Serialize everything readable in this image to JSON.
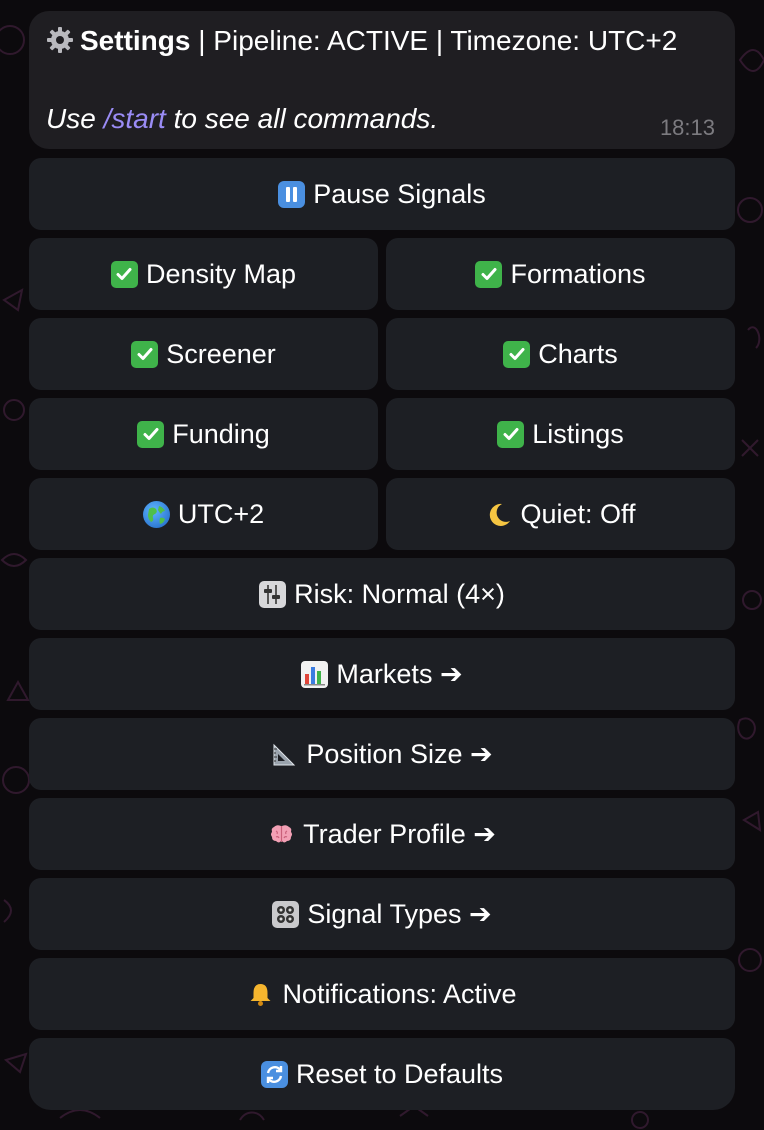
{
  "message": {
    "title_prefix": "Settings",
    "title_rest": " | Pipeline: ACTIVE | Timezone: UTC+2",
    "body_before": "Use ",
    "body_command": "/start",
    "body_after": " to see all commands.",
    "time": "18:13"
  },
  "keyboard": {
    "pause_signals": "Pause Signals",
    "density_map": "Density Map",
    "formations": "Formations",
    "screener": "Screener",
    "charts": "Charts",
    "funding": "Funding",
    "listings": "Listings",
    "timezone": "UTC+2",
    "quiet": "Quiet: Off",
    "risk": "Risk: Normal (4×)",
    "markets": "Markets ➔",
    "position_size": "Position Size ➔",
    "trader_profile": "Trader Profile ➔",
    "signal_types": "Signal Types ➔",
    "notifications": "Notifications: Active",
    "reset": "Reset to Defaults"
  },
  "colors": {
    "background": "#0c0a0d",
    "bubble": "#1f1e22",
    "button": "#1d1f24",
    "command_link": "#9a8cf5",
    "timestamp": "#7c7b80",
    "check_green": "#3fb34a",
    "pause_blue": "#4a8fe0"
  },
  "icons": {
    "title": "gear-icon",
    "pause": "pause-icon",
    "enabled": "check-mark-icon",
    "timezone": "globe-icon",
    "quiet": "crescent-moon-icon",
    "risk": "control-knobs-icon",
    "markets": "bar-chart-icon",
    "position_size": "triangular-ruler-icon",
    "trader_profile": "brain-icon",
    "signal_types": "control-panel-icon",
    "notifications": "bell-icon",
    "reset": "refresh-icon"
  }
}
